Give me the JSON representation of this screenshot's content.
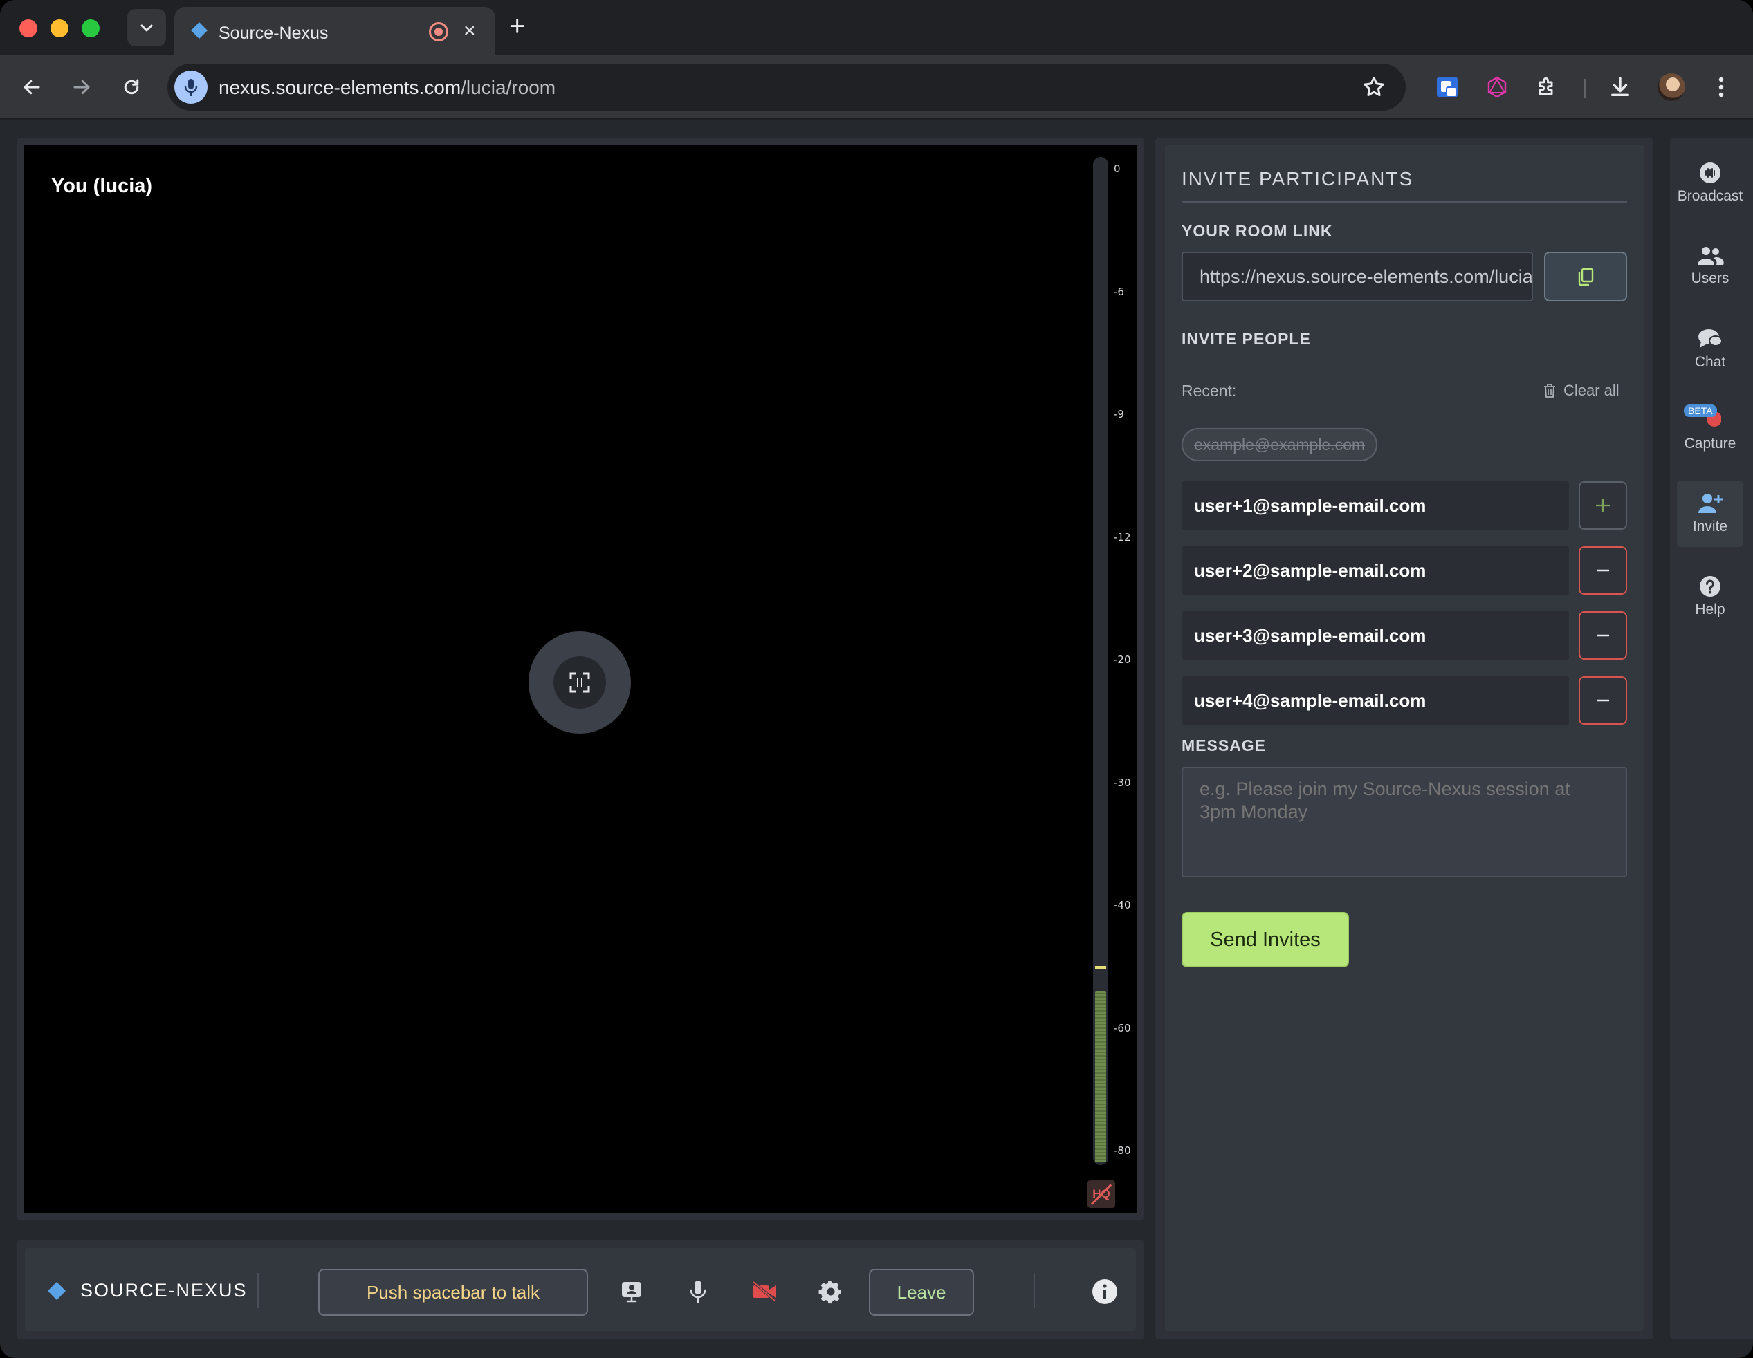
{
  "browser": {
    "tab_title": "Source-Nexus",
    "tab_close_icon": "×",
    "new_tab_icon": "+",
    "url_host": "nexus.source-elements.com",
    "url_path": "/lucia/room"
  },
  "video": {
    "participant_name": "You (lucia)",
    "meter_labels": [
      "0",
      "-6",
      "-9",
      "-12",
      "-20",
      "-30",
      "-40",
      "-60",
      "-80"
    ],
    "meter_level": 0.17,
    "meter_peak": 0.195,
    "hq_label": "HQ"
  },
  "bottom_bar": {
    "brand": "SOURCE-NEXUS",
    "push_to_talk": "Push spacebar to talk",
    "leave": "Leave"
  },
  "invite": {
    "title": "INVITE PARTICIPANTS",
    "room_link_label": "YOUR ROOM LINK",
    "room_link_value": "https://nexus.source-elements.com/lucia/room",
    "invite_people_label": "INVITE PEOPLE",
    "recent_label": "Recent:",
    "clear_all": "Clear all",
    "recent_emails": [
      "example@example.com"
    ],
    "emails": [
      "user+1@sample-email.com",
      "user+2@sample-email.com",
      "user+3@sample-email.com",
      "user+4@sample-email.com"
    ],
    "message_label": "MESSAGE",
    "message_placeholder": "e.g. Please join my Source-Nexus session at 3pm Monday",
    "send_button": "Send Invites"
  },
  "rail": {
    "items": [
      {
        "label": "Broadcast",
        "icon": "broadcast-icon"
      },
      {
        "label": "Users",
        "icon": "users-icon"
      },
      {
        "label": "Chat",
        "icon": "chat-icon"
      },
      {
        "label": "Capture",
        "icon": "capture-icon",
        "badge": "BETA"
      },
      {
        "label": "Invite",
        "icon": "invite-icon",
        "active": true
      },
      {
        "label": "Help",
        "icon": "help-icon"
      }
    ]
  },
  "colors": {
    "accent_green": "#b7e67a",
    "danger_red": "#d9534f",
    "ptt_yellow": "#f4d488",
    "brand_blue": "#4a8fd8"
  }
}
